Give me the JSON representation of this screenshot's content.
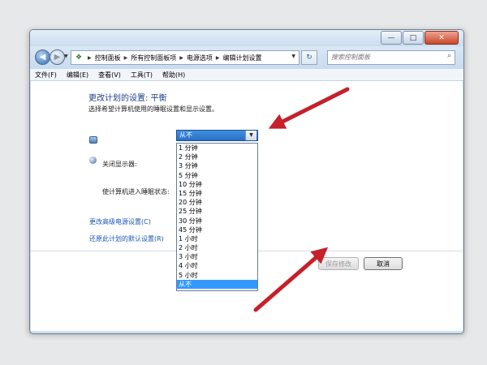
{
  "window": {
    "caption_buttons": {
      "minimize": "—",
      "maximize": "□",
      "close": "✕"
    }
  },
  "address_bar": {
    "back_glyph": "◀",
    "forward_glyph": "▶",
    "breadcrumbs": [
      "控制面板",
      "所有控制面板项",
      "电源选项",
      "编辑计划设置"
    ],
    "refresh_glyph": "↻",
    "search_placeholder": "搜索控制面板"
  },
  "menu": {
    "items": [
      "文件(F)",
      "编辑(E)",
      "查看(V)",
      "工具(T)",
      "帮助(H)"
    ]
  },
  "content": {
    "title": "更改计划的设置: 平衡",
    "subtitle": "选择希望计算机使用的睡眠设置和显示设置。",
    "display_label": "关闭显示器:",
    "display_value": "从不",
    "sleep_label": "使计算机进入睡眠状态:",
    "link_advanced": "更改高级电源设置(C)",
    "link_restore": "还原此计划的默认设置(R)",
    "save_button": "保存修改",
    "cancel_button": "取消"
  },
  "dropdown": {
    "options": [
      "1 分钟",
      "2 分钟",
      "3 分钟",
      "5 分钟",
      "10 分钟",
      "15 分钟",
      "20 分钟",
      "25 分钟",
      "30 分钟",
      "45 分钟",
      "1 小时",
      "2 小时",
      "3 小时",
      "4 小时",
      "5 小时",
      "从不"
    ],
    "selected": "从不"
  },
  "annotations": {
    "arrow_color": "#c6202a"
  },
  "colors": {
    "title_blue": "#1e3f8a",
    "link_blue": "#1a56b8",
    "selection_blue": "#3398ff"
  }
}
